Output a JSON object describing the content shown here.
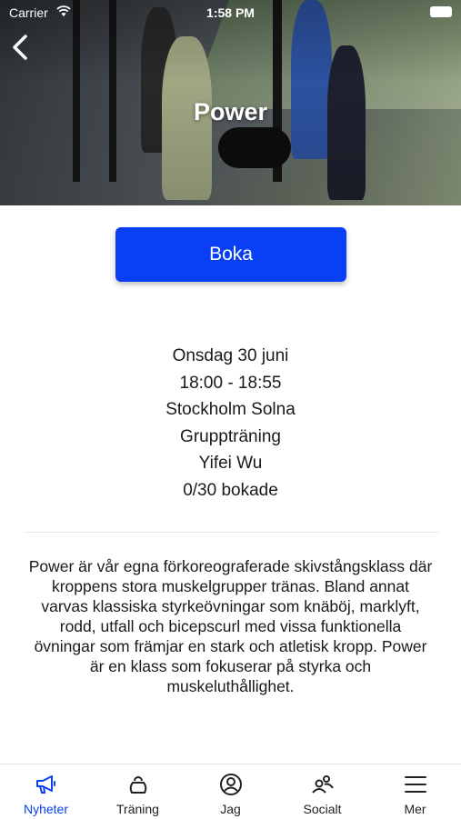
{
  "status_bar": {
    "carrier": "Carrier",
    "time": "1:58 PM"
  },
  "hero": {
    "title": "Power"
  },
  "booking": {
    "button_label": "Boka"
  },
  "details": {
    "date": "Onsdag 30 juni",
    "time": "18:00 - 18:55",
    "location": "Stockholm Solna",
    "category": "Gruppträning",
    "instructor": "Yifei Wu",
    "booked": "0/30 bokade"
  },
  "description": "Power är vår egna förkoreograferade skivstångsklass där kroppens stora muskelgrupper tränas. Bland annat varvas klassiska styrkeövningar som knäböj, marklyft, rodd, utfall och bicepscurl med vissa funktionella övningar som främjar en stark och atletisk kropp. Power är en klass som fokuserar på styrka och muskeluthållighet.",
  "tabbar": {
    "accent_color": "#0a40f5",
    "items": [
      {
        "label": "Nyheter",
        "icon": "megaphone-icon",
        "active": true
      },
      {
        "label": "Träning",
        "icon": "kettlebell-icon",
        "active": false
      },
      {
        "label": "Jag",
        "icon": "profile-icon",
        "active": false
      },
      {
        "label": "Socialt",
        "icon": "people-icon",
        "active": false
      },
      {
        "label": "Mer",
        "icon": "menu-icon",
        "active": false
      }
    ]
  }
}
